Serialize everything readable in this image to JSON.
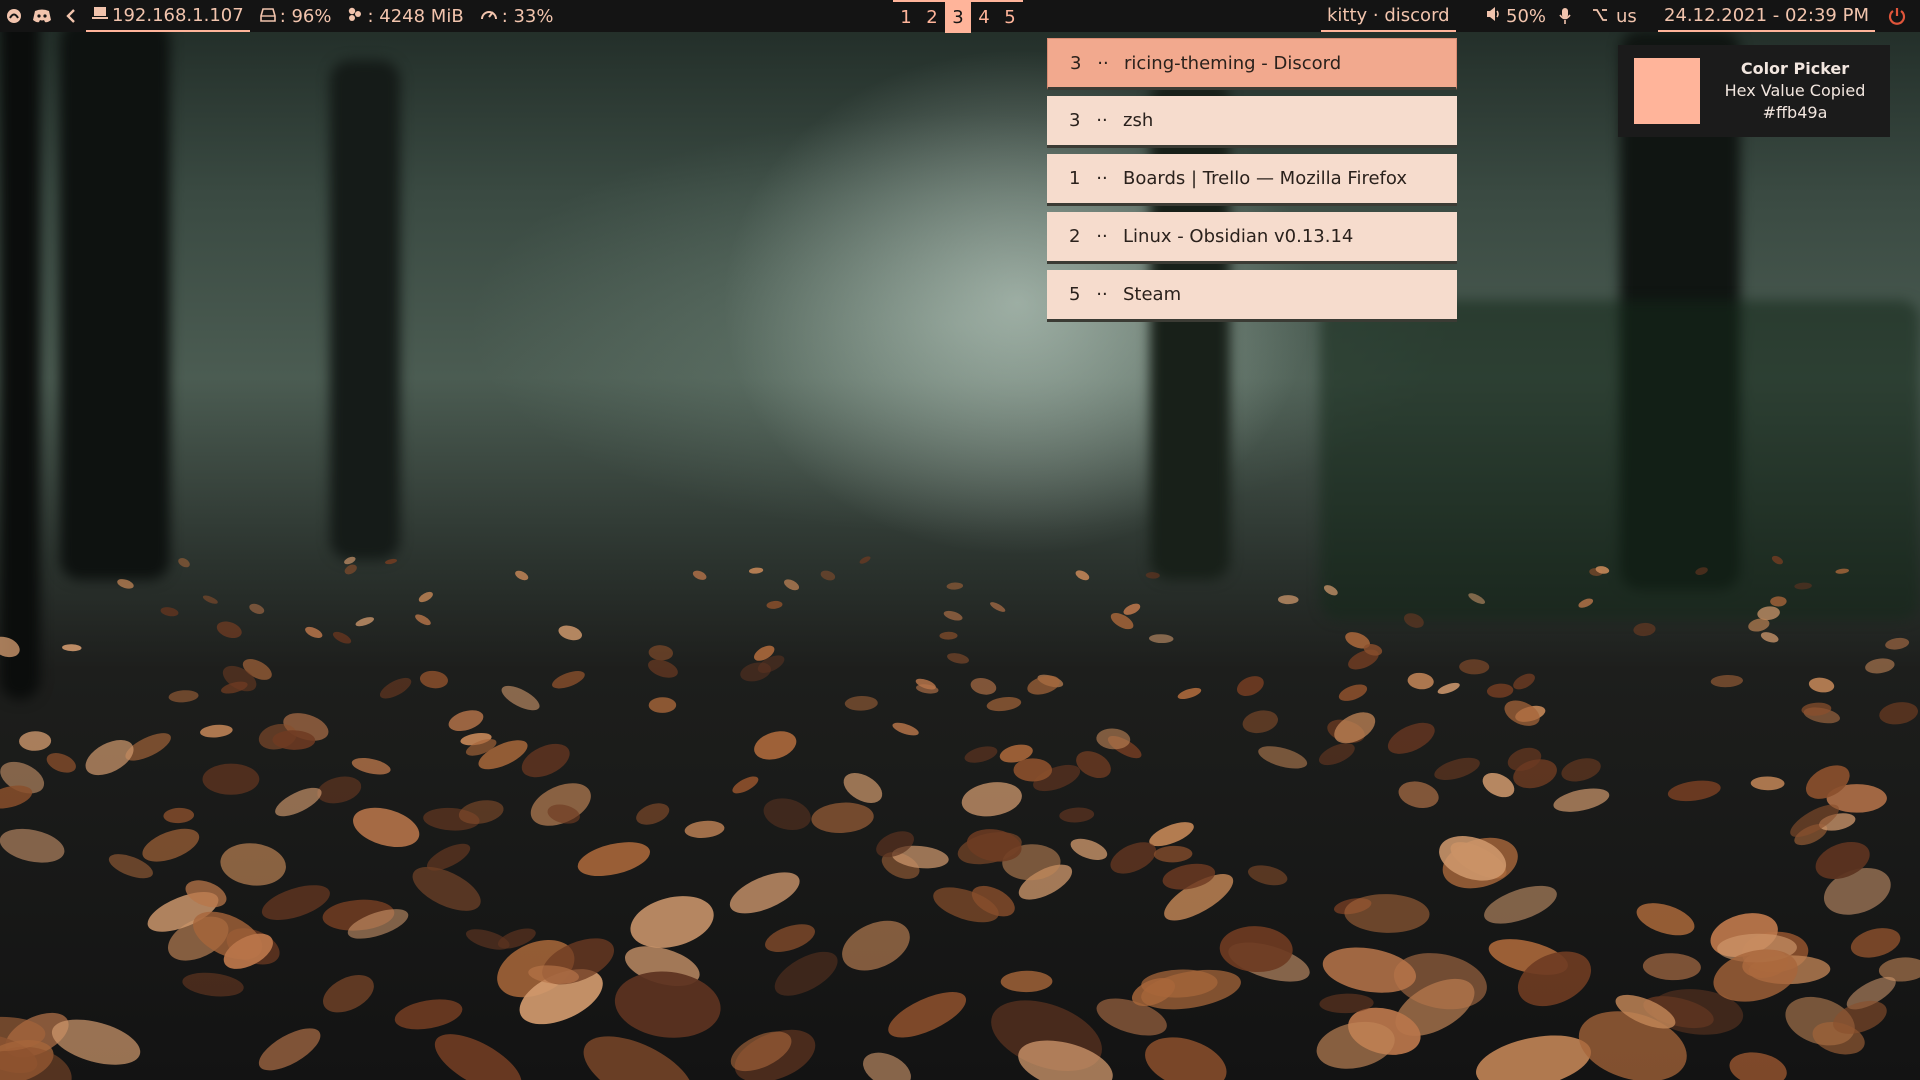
{
  "topbar": {
    "ip": "192.168.1.107",
    "disk": ": 96%",
    "memory": ": 4248 MiB",
    "cpu": ": 33%",
    "workspaces": [
      "1",
      "2",
      "3",
      "4",
      "5"
    ],
    "active_workspace": "3",
    "window_title": "kitty · discord",
    "volume": "50%",
    "keyboard_layout": "us",
    "datetime": "24.12.2021 - 02:39 PM"
  },
  "switcher": {
    "items": [
      {
        "workspace": "3",
        "sep": "··",
        "title": "ricing-theming - Discord",
        "selected": true
      },
      {
        "workspace": "3",
        "sep": "··",
        "title": "zsh",
        "selected": false
      },
      {
        "workspace": "1",
        "sep": "··",
        "title": "Boards | Trello — Mozilla Firefox",
        "selected": false
      },
      {
        "workspace": "2",
        "sep": "··",
        "title": "Linux - Obsidian v0.13.14",
        "selected": false
      },
      {
        "workspace": "5",
        "sep": "··",
        "title": "Steam",
        "selected": false
      }
    ]
  },
  "notification": {
    "title": "Color Picker",
    "body": "Hex Value Copied",
    "value": "#ffb49a",
    "swatch_color": "#ffb49a"
  },
  "colors": {
    "accent": "#ffb49a",
    "bar_bg": "#141414",
    "power": "#e0553a"
  },
  "icons": [
    "arch-icon",
    "discord-icon",
    "chevron-left-icon",
    "computer-icon",
    "disk-icon",
    "memory-icon",
    "cpu-gauge-icon",
    "volume-icon",
    "microphone-icon",
    "keyboard-icon",
    "power-icon"
  ]
}
